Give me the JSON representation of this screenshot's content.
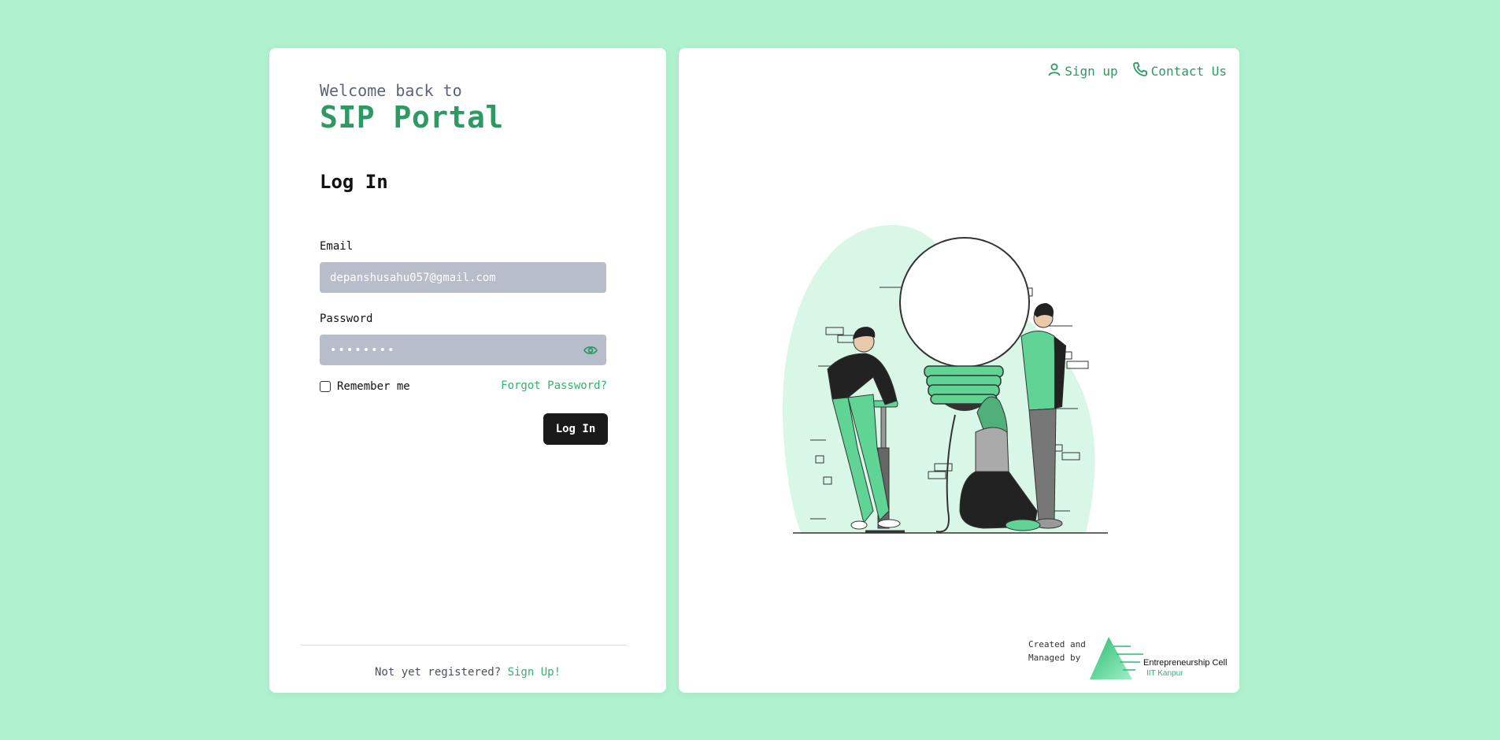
{
  "login": {
    "welcome": "Welcome back to",
    "portal_name": "SIP Portal",
    "heading": "Log In",
    "email_label": "Email",
    "email_value": "depanshusahu057@gmail.com",
    "password_label": "Password",
    "password_value": "••••••••",
    "remember_label": "Remember me",
    "forgot_label": "Forgot Password?",
    "login_button": "Log In",
    "footer_text": "Not yet registered?",
    "footer_link": "Sign Up!"
  },
  "nav": {
    "signup": "Sign up",
    "contact": "Contact Us"
  },
  "credits": {
    "line1": "Created and",
    "line2": "Managed by",
    "org_name": "Entrepreneurship Cell",
    "org_sub": "IIT Kanpur"
  },
  "colors": {
    "background": "#b0f2cf",
    "accent": "#2e9a63",
    "link": "#35b071",
    "input_bg": "#b8bdcb",
    "button_bg": "#1a1a1a"
  },
  "icons": [
    "user-icon",
    "phone-icon",
    "eye-icon"
  ]
}
